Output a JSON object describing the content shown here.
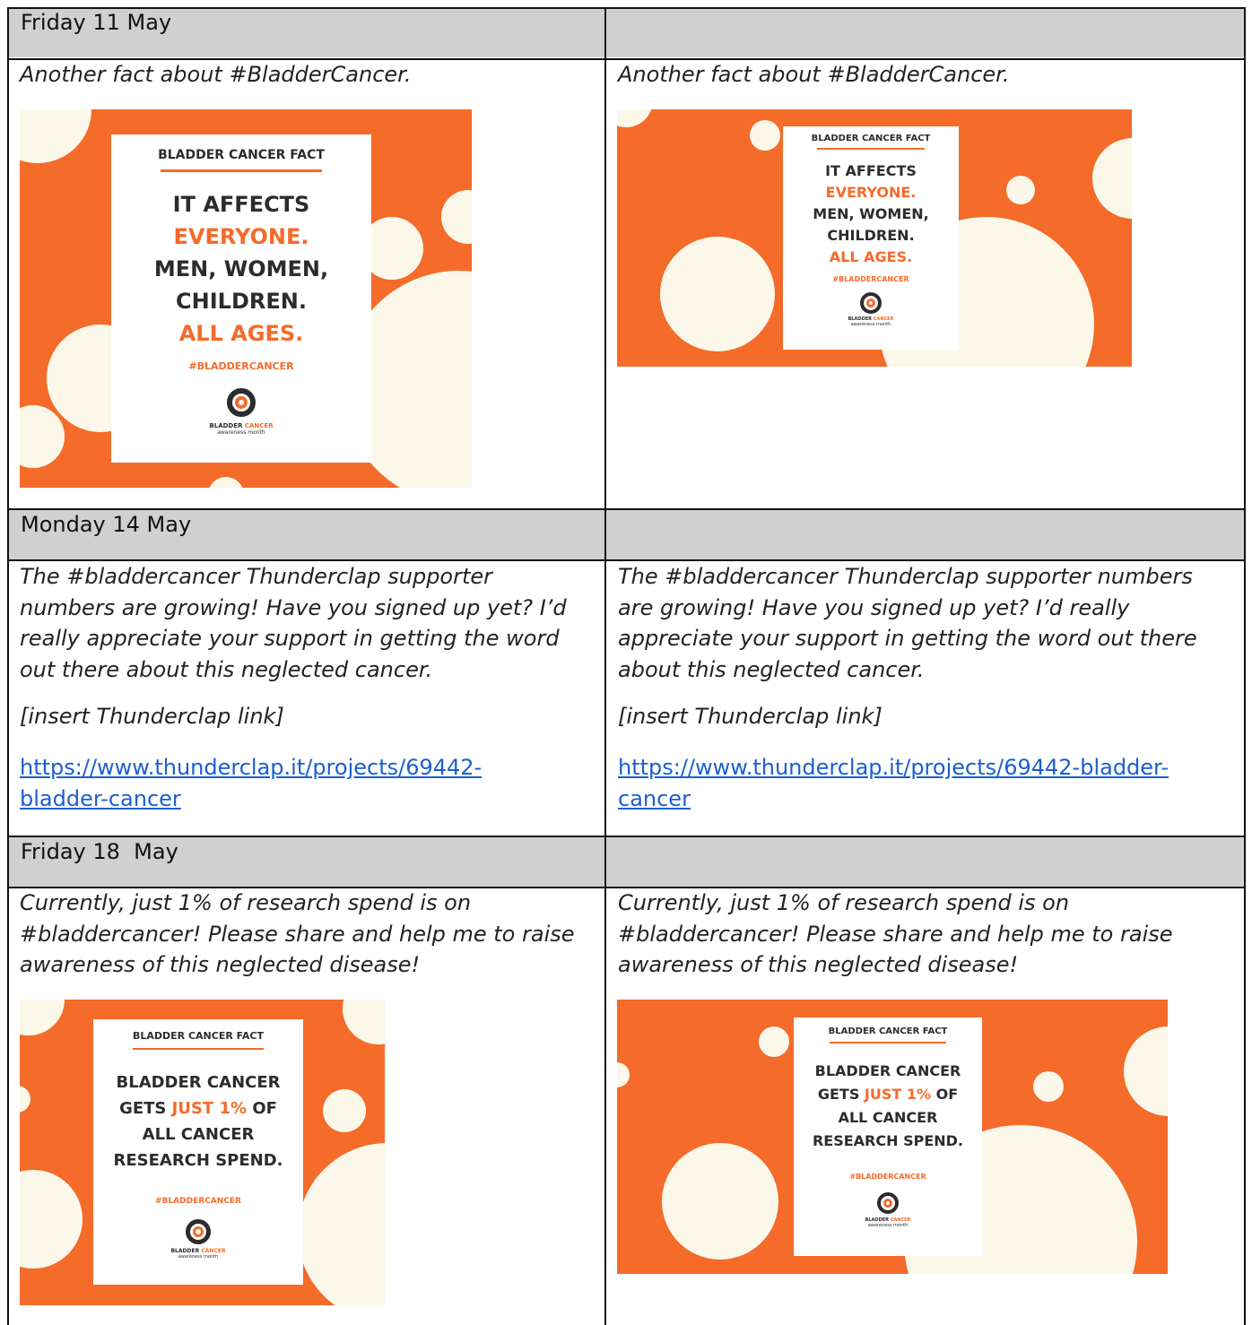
{
  "rows": [
    {
      "date": "Friday 11 May",
      "left_text": "Another fact about #BladderCancer.",
      "right_text": "Another fact about #BladderCancer."
    },
    {
      "date": "Monday 14 May",
      "left_text": "The #bladdercancer Thunderclap supporter numbers are growing! Have you signed up yet? I’d really appreciate your support in getting the word out there about this neglected cancer.",
      "left_note": "[insert Thunderclap link]",
      "left_link": "https://www.thunderclap.it/projects/69442-bladder-cancer",
      "right_text": "The #bladdercancer Thunderclap supporter numbers are growing! Have you signed up yet? I’d really appreciate your support in getting the word out there about this neglected cancer.",
      "right_note": "[insert Thunderclap link]",
      "right_link": "https://www.thunderclap.it/projects/69442-bladder-cancer"
    },
    {
      "date": "Friday 18  May",
      "left_text": "Currently, just 1% of research spend is on #bladdercancer! Please share and help me to raise awareness of this neglected disease!",
      "right_text": "Currently, just 1% of research spend is on #bladdercancer! Please share and help me to raise awareness of this neglected disease!"
    }
  ],
  "poster1": {
    "heading": "BLADDER CANCER FACT",
    "l1": "IT AFFECTS",
    "l2": "EVERYONE.",
    "l3": "MEN, WOMEN,",
    "l4": "CHILDREN.",
    "l5": "ALL AGES.",
    "hashtag": "#BLADDERCANCER",
    "logo_a": "BLADDER",
    "logo_b": "CANCER",
    "logo_c": "awareness month"
  },
  "poster2": {
    "heading": "BLADDER CANCER FACT",
    "l1": "BLADDER CANCER",
    "l2a": "GETS ",
    "l2b": "JUST 1%",
    "l2c": " OF",
    "l3": "ALL CANCER",
    "l4": "RESEARCH SPEND.",
    "hashtag": "#BLADDERCANCER",
    "logo_a": "BLADDER",
    "logo_b": "CANCER",
    "logo_c": "awareness month"
  },
  "colors": {
    "brand_orange": "#f46b2a",
    "dot_cream": "#fbf8ea",
    "header_gray": "#d0d0d0",
    "link_blue": "#1a5fd0"
  }
}
